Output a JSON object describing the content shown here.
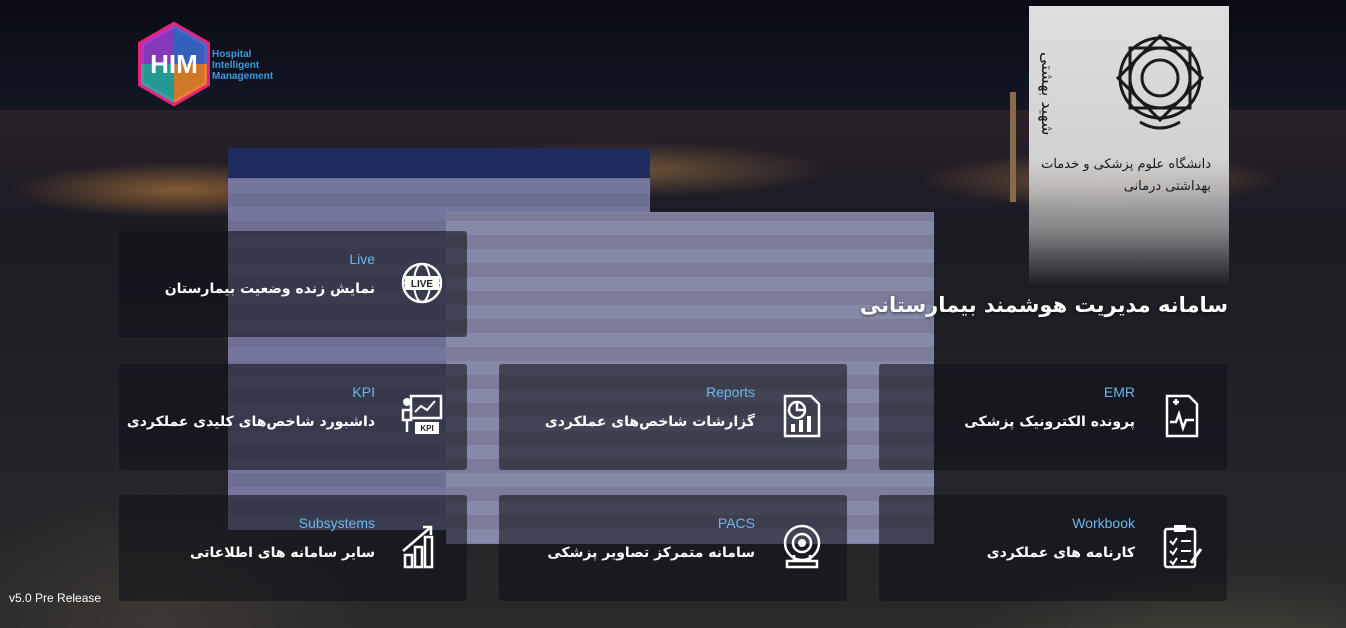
{
  "branding": {
    "hospital_logo_lines": [
      "Hospital",
      "Intelligent",
      "Management"
    ],
    "hospital_logo_letters": "HIM",
    "university_logo_text": [
      "دانشگاه علوم پزشکی و خدمات بهداشتی درمانی",
      "شهید بهشتی"
    ]
  },
  "app_title": "سامانه مدیریت هوشمند بیمارستانی",
  "tiles": [
    {
      "id": "live",
      "en": "Live",
      "fa": "نمایش زنده وضعیت بیمارستان",
      "icon": "live-globe-icon"
    },
    {
      "id": "emr",
      "en": "EMR",
      "fa": "پرونده الکترونیک پزشکی",
      "icon": "medical-record-icon"
    },
    {
      "id": "reports",
      "en": "Reports",
      "fa": "گزارشات شاخص‌های عملکردی",
      "icon": "report-chart-icon"
    },
    {
      "id": "kpi",
      "en": "KPI",
      "fa": "داشبورد شاخص‌های کلیدی عملکردی",
      "icon": "kpi-board-icon"
    },
    {
      "id": "workbook",
      "en": "Workbook",
      "fa": "کارنامه های عملکردی",
      "icon": "checklist-icon"
    },
    {
      "id": "pacs",
      "en": "PACS",
      "fa": "سامانه متمرکز تصاویر پزشکی",
      "icon": "mri-scanner-icon"
    },
    {
      "id": "subsystems",
      "en": "Subsystems",
      "fa": "سایر سامانه های اطلاعاتی",
      "icon": "growth-bars-icon"
    }
  ],
  "version": "v5.0 Pre Release",
  "colors": {
    "accent_blue": "#6fb6ea",
    "tile_bg": "rgba(16,17,24,0.58)"
  }
}
